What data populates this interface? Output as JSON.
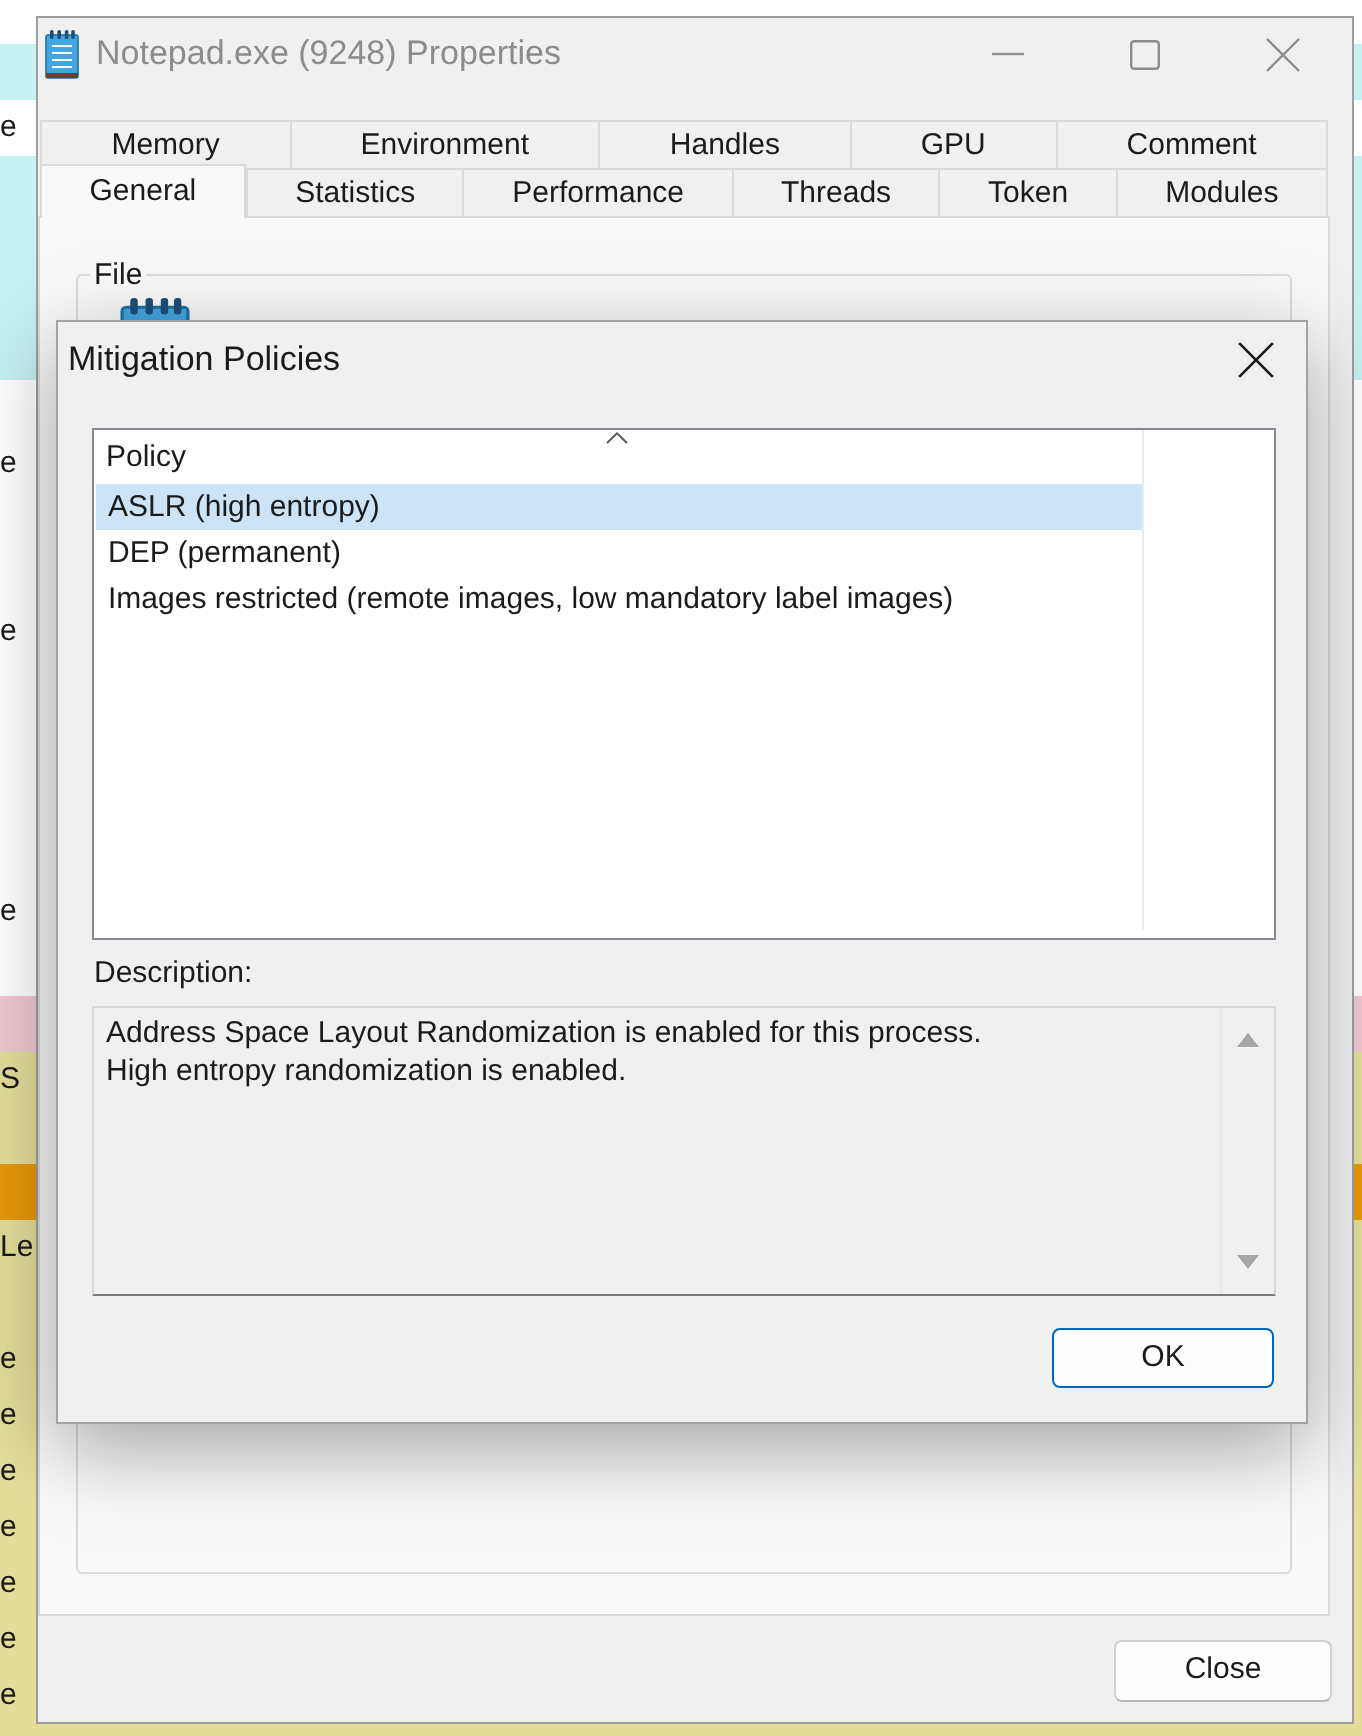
{
  "process_list": {
    "rows": [
      {
        "color": "#c6f1f1"
      },
      {
        "text": "e"
      },
      {
        "color": "#c6f1f1"
      },
      {
        "color": "#c6f1f1"
      },
      {
        "color": "#c6f1f1"
      },
      {
        "color": "#c6f1f1"
      },
      {},
      {
        "text": "e"
      },
      {},
      {},
      {
        "text": "e"
      },
      {},
      {},
      {},
      {},
      {
        "text": "e"
      },
      {},
      {
        "color": "#f0c8d2"
      },
      {
        "text": "S",
        "color": "#e2de9a"
      },
      {
        "color": "#e2de9a"
      },
      {
        "color": "#e8980c"
      },
      {
        "text": "Le",
        "color": "#e2de9a"
      },
      {
        "color": "#e2de9a"
      },
      {
        "text": "e",
        "color": "#e2de9a"
      },
      {
        "text": "e",
        "color": "#e2de9a"
      },
      {
        "text": "e",
        "color": "#e2de9a"
      },
      {
        "text": "e",
        "color": "#e2de9a"
      },
      {
        "text": "e",
        "color": "#e2de9a"
      },
      {
        "text": "e",
        "color": "#e2de9a"
      },
      {
        "text": "e",
        "color": "#e2de9a"
      },
      {
        "color": "#e2de9a"
      }
    ]
  },
  "properties_window": {
    "title": "Notepad.exe (9248) Properties",
    "active": false,
    "tab_rows": [
      [
        {
          "label": "Memory",
          "selected": false
        },
        {
          "label": "Environment",
          "selected": false
        },
        {
          "label": "Handles",
          "selected": false
        },
        {
          "label": "GPU",
          "selected": false
        },
        {
          "label": "Comment",
          "selected": false
        }
      ],
      [
        {
          "label": "General",
          "selected": true
        },
        {
          "label": "Statistics",
          "selected": false
        },
        {
          "label": "Performance",
          "selected": false
        },
        {
          "label": "Threads",
          "selected": false
        },
        {
          "label": "Token",
          "selected": false
        },
        {
          "label": "Modules",
          "selected": false
        }
      ]
    ],
    "file_group": {
      "title": "File"
    },
    "buttons": [
      "Close"
    ]
  },
  "dialog": {
    "title": "Mitigation Policies",
    "list": {
      "columns": [
        {
          "label": "Policy",
          "sort_ascending": true
        }
      ],
      "rows": [
        {
          "label": "ASLR (high entropy)",
          "selected": true
        },
        {
          "label": "DEP (permanent)",
          "selected": false
        },
        {
          "label": "Images restricted (remote images, low mandatory label images)",
          "selected": false
        }
      ]
    },
    "description_label": "Description:",
    "description": "Address Space Layout Randomization is enabled for this process.\nHigh entropy randomization is enabled.",
    "buttons": [
      "OK"
    ]
  }
}
